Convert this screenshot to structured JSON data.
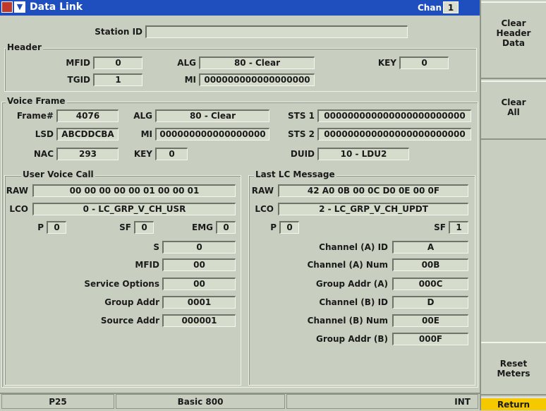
{
  "titlebar": {
    "title": "Data Link",
    "chan_label": "Chan",
    "chan_value": "1"
  },
  "station": {
    "label": "Station ID",
    "value": ""
  },
  "header": {
    "title": "Header",
    "mfid_label": "MFID",
    "mfid": "0",
    "alg_label": "ALG",
    "alg": "80 - Clear",
    "key_label": "KEY",
    "key": "0",
    "tgid_label": "TGID",
    "tgid": "1",
    "mi_label": "MI",
    "mi": "000000000000000000"
  },
  "voice_frame": {
    "title": "Voice Frame",
    "frame_label": "Frame#",
    "frame": "4076",
    "alg_label": "ALG",
    "alg": "80 - Clear",
    "sts1_label": "STS 1",
    "sts1": "000000000000000000000000",
    "lsd_label": "LSD",
    "lsd": "ABCDDCBA",
    "mi_label": "MI",
    "mi": "000000000000000000",
    "sts2_label": "STS 2",
    "sts2": "000000000000000000000000",
    "nac_label": "NAC",
    "nac": "293",
    "key_label": "KEY",
    "key": "0",
    "duid_label": "DUID",
    "duid": "10 - LDU2"
  },
  "user_voice_call": {
    "title": "User Voice Call",
    "raw_label": "RAW",
    "raw": "00 00 00 00 00 01 00 00 01",
    "lco_label": "LCO",
    "lco": "0 - LC_GRP_V_CH_USR",
    "p_label": "P",
    "p": "0",
    "sf_label": "SF",
    "sf": "0",
    "emg_label": "EMG",
    "emg": "0",
    "s_label": "S",
    "s": "0",
    "mfid_label": "MFID",
    "mfid": "00",
    "svc_label": "Service Options",
    "svc": "00",
    "grp_label": "Group Addr",
    "grp": "0001",
    "src_label": "Source Addr",
    "src": "000001"
  },
  "last_lc": {
    "title": "Last LC Message",
    "raw_label": "RAW",
    "raw": "42 A0 0B 00 0C D0 0E 00 0F",
    "lco_label": "LCO",
    "lco": "2 - LC_GRP_V_CH_UPDT",
    "p_label": "P",
    "p": "0",
    "sf_label": "SF",
    "sf": "1",
    "cha_id_label": "Channel (A) ID",
    "cha_id": "A",
    "cha_num_label": "Channel (A) Num",
    "cha_num": "00B",
    "grpa_label": "Group Addr (A)",
    "grpa": "000C",
    "chb_id_label": "Channel (B) ID",
    "chb_id": "D",
    "chb_num_label": "Channel (B) Num",
    "chb_num": "00E",
    "grpb_label": "Group Addr (B)",
    "grpb": "000F"
  },
  "sidebar": {
    "clear_header": "Clear\nHeader\nData",
    "clear_all": "Clear\nAll",
    "reset_meters": "Reset\nMeters",
    "return": "Return"
  },
  "status": {
    "mode": "P25",
    "system": "Basic 800",
    "ref": "INT"
  }
}
